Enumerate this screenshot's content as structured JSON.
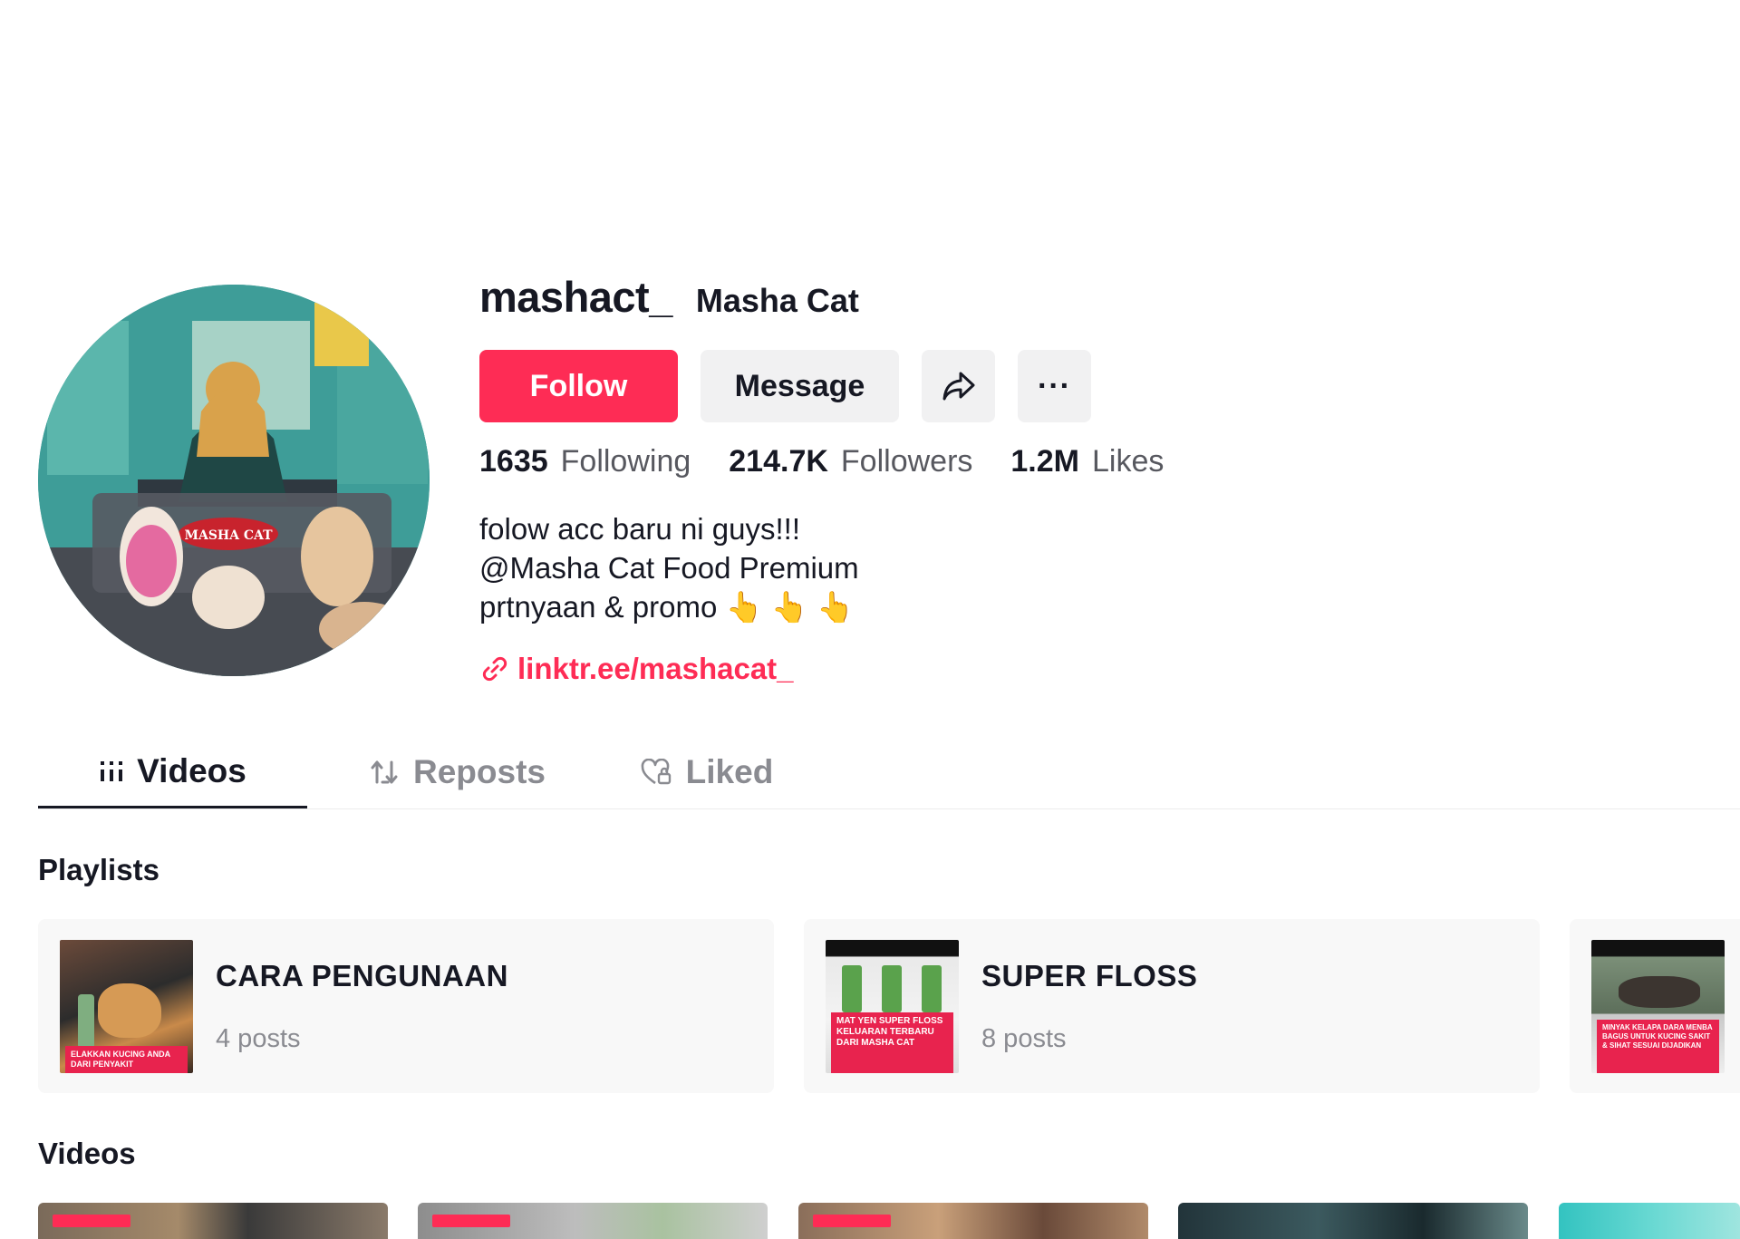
{
  "profile": {
    "username": "mashact_",
    "nickname": "Masha Cat",
    "avatar_logo_text": "MASHA CAT",
    "buttons": {
      "follow": "Follow",
      "message": "Message",
      "share_icon": "share-arrow-icon",
      "more_icon": "ellipsis-icon",
      "more_glyph": "···"
    },
    "stats": [
      {
        "value": "1635",
        "label": "Following"
      },
      {
        "value": "214.7K",
        "label": "Followers"
      },
      {
        "value": "1.2M",
        "label": "Likes"
      }
    ],
    "bio": [
      "folow acc baru ni guys!!!",
      "@Masha Cat Food Premium",
      "prtnyaan & promo 👆 👆 👆"
    ],
    "link": "linktr.ee/mashacat_"
  },
  "tabs": [
    {
      "label": "Videos",
      "icon": "grid-icon",
      "active": true
    },
    {
      "label": "Reposts",
      "icon": "repost-icon",
      "active": false
    },
    {
      "label": "Liked",
      "icon": "heart-lock-icon",
      "active": false
    }
  ],
  "sections": {
    "playlists": "Playlists",
    "videos": "Videos"
  },
  "playlists": [
    {
      "title": "CARA PENGUNAAN",
      "count": "4 posts",
      "thumb_caption": "ELAKKAN KUCING ANDA DARI PENYAKIT"
    },
    {
      "title": "SUPER FLOSS",
      "count": "8 posts",
      "thumb_caption": "MAT YEN SUPER FLOSS KELUARAN TERBARU DARI MASHA CAT"
    },
    {
      "title": "",
      "count": "",
      "thumb_caption": "MINYAK KELAPA DARA MENBA BAGUS UNTUK KUCING SAKIT & SIHAT SESUAI DIJADIKAN"
    }
  ],
  "colors": {
    "accent": "#fe2c55",
    "text": "#161823",
    "muted": "#8a8b91",
    "button_bg": "#f1f1f2"
  }
}
